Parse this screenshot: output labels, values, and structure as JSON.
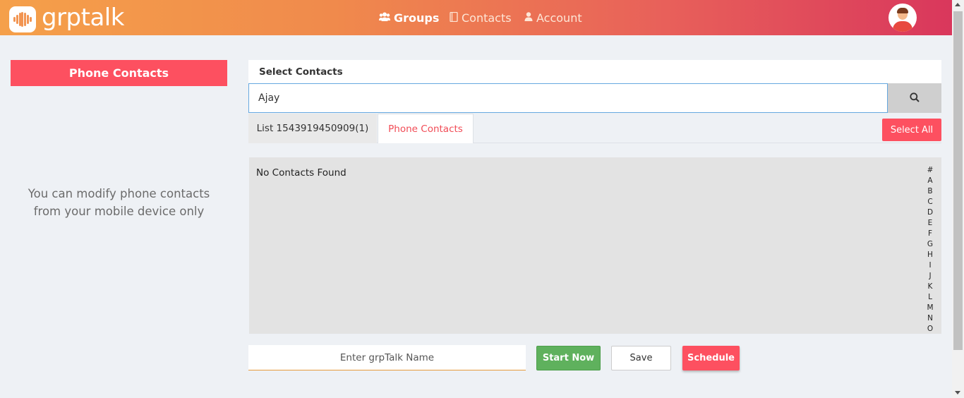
{
  "app": {
    "logo_text": "grptalk"
  },
  "nav": {
    "groups": {
      "label": "Groups",
      "icon": "users-icon"
    },
    "contacts": {
      "label": "Contacts",
      "icon": "address-book-icon"
    },
    "account": {
      "label": "Account",
      "icon": "user-icon"
    }
  },
  "left_panel": {
    "title": "Phone Contacts",
    "note_line1": "You can modify phone contacts",
    "note_line2": "from your mobile device only"
  },
  "main": {
    "heading": "Select Contacts",
    "search": {
      "value": "Ajay",
      "icon": "search-icon"
    },
    "tabs": [
      {
        "label": "List 1543919450909(1)",
        "active": false
      },
      {
        "label": "Phone Contacts",
        "active": true
      }
    ],
    "select_all_label": "Select All",
    "empty_message": "No Contacts Found",
    "alphabet": [
      "#",
      "A",
      "B",
      "C",
      "D",
      "E",
      "F",
      "G",
      "H",
      "I",
      "J",
      "K",
      "L",
      "M",
      "N",
      "O"
    ]
  },
  "footer": {
    "name_placeholder": "Enter grpTalk Name",
    "start_label": "Start Now",
    "save_label": "Save",
    "schedule_label": "Schedule"
  },
  "colors": {
    "accent_red": "#fd5060",
    "start_green": "#5fb15d",
    "header_gradient_start": "#f5a04a",
    "header_gradient_end": "#d9375c"
  }
}
